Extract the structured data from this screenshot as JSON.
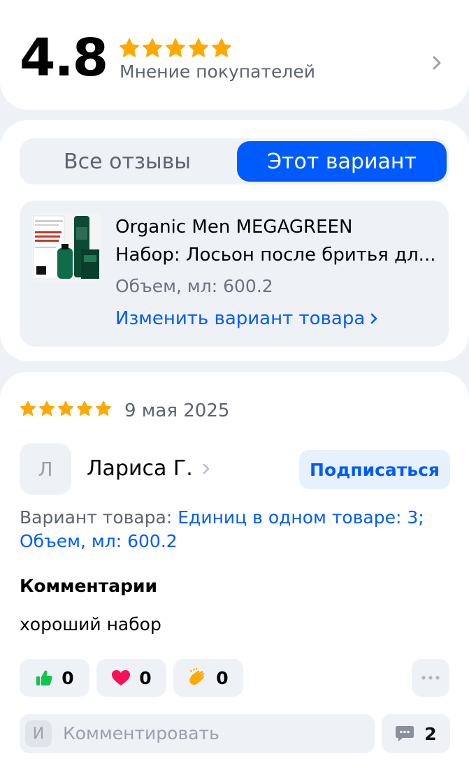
{
  "rating": {
    "value": "4.8",
    "stars": 5,
    "caption": "Мнение покупателей"
  },
  "filter": {
    "tabs": [
      "Все отзывы",
      "Этот вариант"
    ],
    "selected": "Этот вариант"
  },
  "product": {
    "name_line1": "Organic Men MEGAGREEN",
    "name_line2": "Набор: Лосьон после бритья дл...",
    "volume": "Объем, мл: 600.2",
    "change_link": "Изменить вариант товара"
  },
  "review": {
    "stars": 5,
    "date": "9 мая 2025",
    "author_initial": "Л",
    "author_name": "Лариса Г.",
    "subscribe_label": "Подписаться",
    "variant_label": "Вариант товара:",
    "variant_value": "Единиц в одном товаре: 3; Объем, мл: 600.2",
    "comments_title": "Комментарии",
    "comment": "хороший набор",
    "reactions": {
      "like": "0",
      "heart": "0",
      "clap": "0"
    },
    "comment_input": {
      "avatar_initial": "И",
      "placeholder": "Комментировать"
    },
    "comment_count": "2"
  },
  "colors": {
    "accent": "#005bff",
    "star": "#ffa800",
    "heart": "#f91155",
    "like": "#10c44c",
    "background": "#eef2f7"
  }
}
